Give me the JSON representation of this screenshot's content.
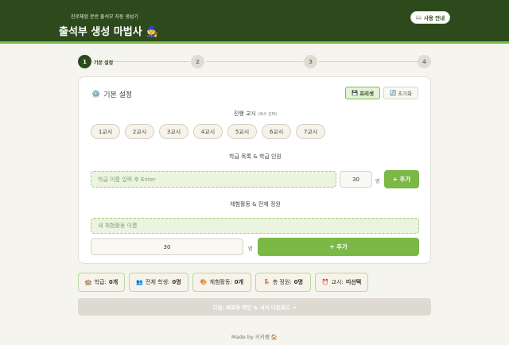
{
  "header": {
    "subtitle": "진로체험 분반 출석부 자동 생성기",
    "title": "출석부 생성 마법사",
    "title_icon": "🧙",
    "guide_icon": "📖",
    "guide_label": "사용 안내"
  },
  "stepper": {
    "steps": [
      "1",
      "2",
      "3",
      "4"
    ],
    "active_label": "기본 설정"
  },
  "card": {
    "title_icon": "⚙️",
    "title": "기본 설정",
    "preset_icon": "💾",
    "preset_label": "프리셋",
    "reset_icon": "🔄",
    "reset_label": "초기화",
    "periods_title": "진행 교시",
    "periods_hint": "(복수 선택)",
    "periods": [
      "1교시",
      "2교시",
      "3교시",
      "4교시",
      "5교시",
      "6교시",
      "7교시"
    ],
    "classes_title": "학급 목록 & 학급 인원",
    "class_placeholder": "학급 이름 입력 후 Enter",
    "class_count": "30",
    "class_unit": "명",
    "class_add": "+ 추가",
    "activities_title": "체험활동 & 전체 정원",
    "activity_placeholder": "새 체험활동 이름",
    "activity_count": "30",
    "activity_unit": "명",
    "activity_add": "+ 추가"
  },
  "stats": [
    {
      "icon": "🏫",
      "label": "학급:",
      "value": "0개"
    },
    {
      "icon": "👥",
      "label": "전체 학생:",
      "value": "0명"
    },
    {
      "icon": "🎨",
      "label": "체험활동:",
      "value": "0개"
    },
    {
      "icon": "🪑",
      "label": "총 정원:",
      "value": "0명"
    },
    {
      "icon": "⏰",
      "label": "교시:",
      "value": "미선택"
    }
  ],
  "next_label": "다음: 배포용 확인 & 서식 다운로드 →",
  "footer": {
    "text": "Made by 키키쌤",
    "icon": "🏠"
  }
}
